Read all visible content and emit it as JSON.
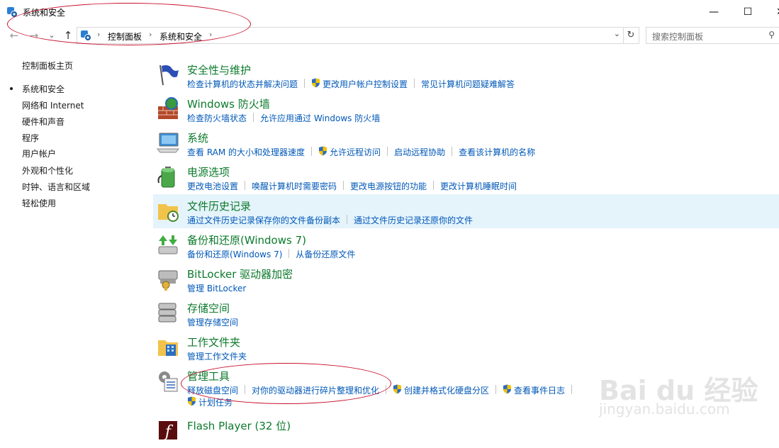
{
  "window": {
    "title": "系统和安全",
    "minimize_glyph": "—",
    "maximize_glyph": "☐",
    "close_glyph": "✕"
  },
  "nav": {
    "back_glyph": "←",
    "forward_glyph": "→",
    "dropdown_glyph": "⌄",
    "up_glyph": "↑"
  },
  "address": {
    "crumbs": [
      "控制面板",
      "系统和安全"
    ],
    "sep": "›",
    "dropdown_glyph": "⌄",
    "refresh_glyph": "↻"
  },
  "search": {
    "placeholder": "搜索控制面板",
    "icon_glyph": "⚲"
  },
  "sidebar": {
    "items": [
      {
        "label": "控制面板主页"
      },
      {
        "label": "系统和安全",
        "selected": true
      },
      {
        "label": "网络和 Internet"
      },
      {
        "label": "硬件和声音"
      },
      {
        "label": "程序"
      },
      {
        "label": "用户帐户"
      },
      {
        "label": "外观和个性化"
      },
      {
        "label": "时钟、语言和区域"
      },
      {
        "label": "轻松使用"
      }
    ]
  },
  "categories": [
    {
      "title": "安全性与维护",
      "icon": "flag-icon",
      "links": [
        {
          "label": "检查计算机的状态并解决问题",
          "shield": false
        },
        {
          "label": "更改用户帐户控制设置",
          "shield": true
        },
        {
          "label": "常见计算机问题疑难解答",
          "shield": false
        }
      ]
    },
    {
      "title": "Windows 防火墙",
      "icon": "firewall-icon",
      "links": [
        {
          "label": "检查防火墙状态",
          "shield": false
        },
        {
          "label": "允许应用通过 Windows 防火墙",
          "shield": false
        }
      ]
    },
    {
      "title": "系统",
      "icon": "computer-icon",
      "links": [
        {
          "label": "查看 RAM 的大小和处理器速度",
          "shield": false
        },
        {
          "label": "允许远程访问",
          "shield": true
        },
        {
          "label": "启动远程协助",
          "shield": false
        },
        {
          "label": "查看该计算机的名称",
          "shield": false
        }
      ]
    },
    {
      "title": "电源选项",
      "icon": "battery-icon",
      "links": [
        {
          "label": "更改电池设置",
          "shield": false
        },
        {
          "label": "唤醒计算机时需要密码",
          "shield": false
        },
        {
          "label": "更改电源按钮的功能",
          "shield": false
        },
        {
          "label": "更改计算机睡眠时间",
          "shield": false
        }
      ]
    },
    {
      "title": "文件历史记录",
      "icon": "file-history-icon",
      "highlighted": true,
      "links": [
        {
          "label": "通过文件历史记录保存你的文件备份副本",
          "shield": false
        },
        {
          "label": "通过文件历史记录还原你的文件",
          "shield": false
        }
      ]
    },
    {
      "title": "备份和还原(Windows 7)",
      "icon": "backup-icon",
      "links": [
        {
          "label": "备份和还原(Windows 7)",
          "shield": false
        },
        {
          "label": "从备份还原文件",
          "shield": false
        }
      ]
    },
    {
      "title": "BitLocker 驱动器加密",
      "icon": "bitlocker-icon",
      "links": [
        {
          "label": "管理 BitLocker",
          "shield": false
        }
      ]
    },
    {
      "title": "存储空间",
      "icon": "storage-icon",
      "links": [
        {
          "label": "管理存储空间",
          "shield": false
        }
      ]
    },
    {
      "title": "工作文件夹",
      "icon": "work-folders-icon",
      "links": [
        {
          "label": "管理工作文件夹",
          "shield": false
        }
      ]
    },
    {
      "title": "管理工具",
      "icon": "admin-tools-icon",
      "links": [
        {
          "label": "释放磁盘空间",
          "shield": false
        },
        {
          "label": "对你的驱动器进行碎片整理和优化",
          "shield": false
        },
        {
          "label": "创建并格式化硬盘分区",
          "shield": true
        },
        {
          "label": "查看事件日志",
          "shield": true
        }
      ],
      "links_row2": [
        {
          "label": "计划任务",
          "shield": true
        }
      ]
    },
    {
      "title": "Flash Player (32 位)",
      "icon": "flash-icon",
      "links": []
    }
  ],
  "watermark": {
    "text": "Bai du 经验",
    "sub": "jingyan.baidu.com"
  },
  "colors": {
    "link": "#0058b8",
    "category_title": "#0c7a2c",
    "highlight": "#e5f3fb",
    "annotation": "#c8102e"
  }
}
